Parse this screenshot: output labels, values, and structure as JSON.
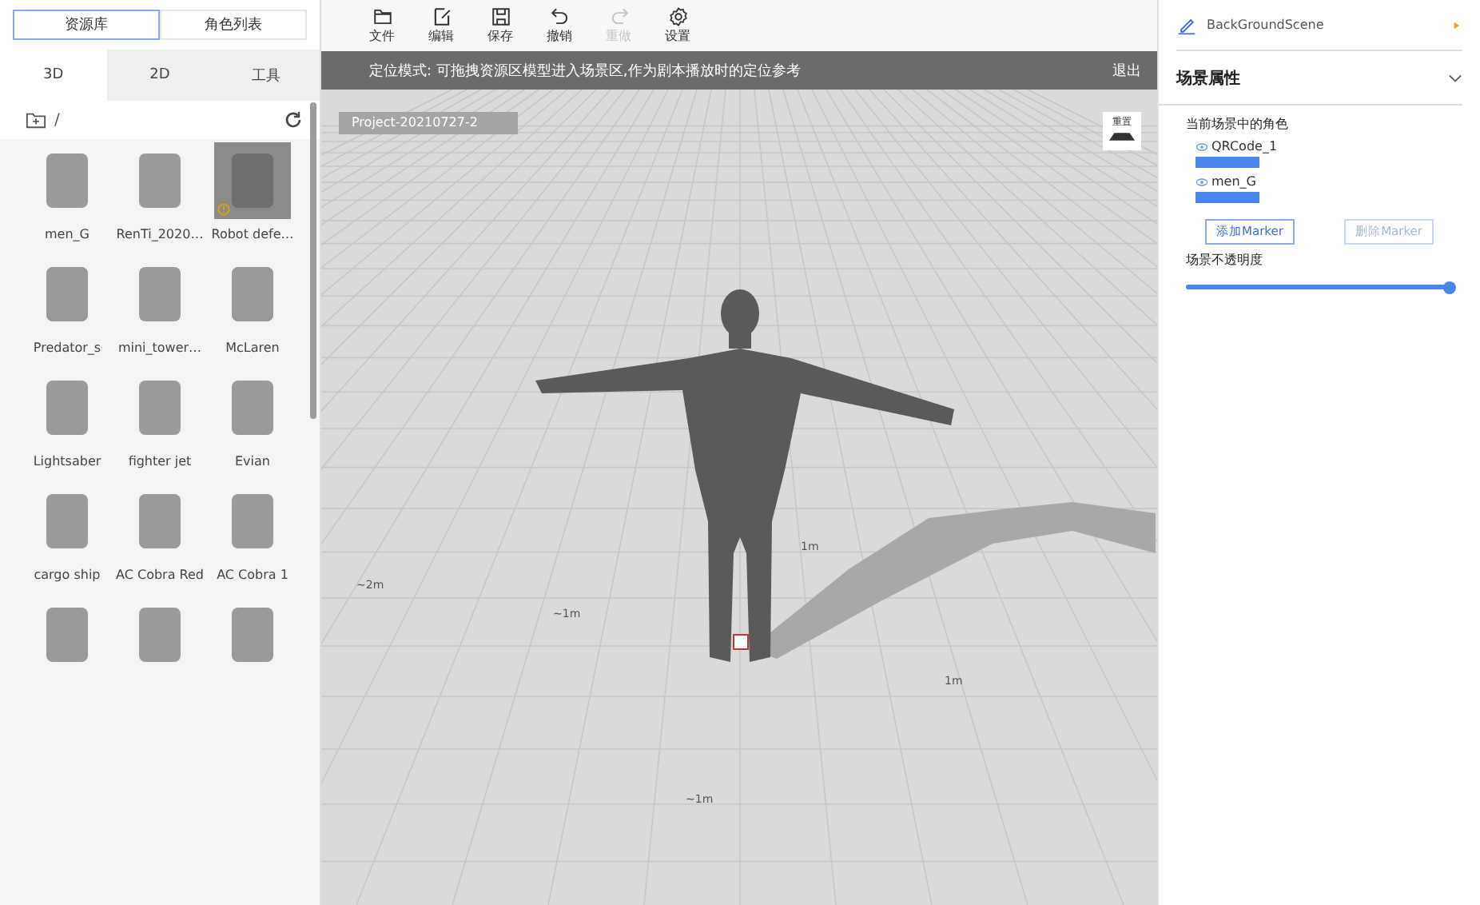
{
  "library_switch": [
    {
      "label": "资源库",
      "selected": true
    },
    {
      "label": "角色列表",
      "selected": false
    }
  ],
  "tabs": [
    {
      "label": "3D",
      "selected": true
    },
    {
      "label": "2D",
      "selected": false
    },
    {
      "label": "工具",
      "selected": false
    }
  ],
  "path": "/",
  "assets": [
    {
      "label": "men_G",
      "selected": false,
      "warning": false
    },
    {
      "label": "RenTi_2020…",
      "selected": false,
      "warning": false
    },
    {
      "label": "Robot defe…",
      "selected": true,
      "warning": true
    },
    {
      "label": "Predator_s",
      "selected": false,
      "warning": false
    },
    {
      "label": "mini_tower…",
      "selected": false,
      "warning": false
    },
    {
      "label": "McLaren",
      "selected": false,
      "warning": false
    },
    {
      "label": "Lightsaber",
      "selected": false,
      "warning": false
    },
    {
      "label": "fighter jet",
      "selected": false,
      "warning": false
    },
    {
      "label": "Evian",
      "selected": false,
      "warning": false
    },
    {
      "label": "cargo ship",
      "selected": false,
      "warning": false
    },
    {
      "label": "AC Cobra Red",
      "selected": false,
      "warning": false
    },
    {
      "label": "AC Cobra 1",
      "selected": false,
      "warning": false
    },
    {
      "selected": false,
      "warning": false
    },
    {
      "selected": false,
      "warning": false
    },
    {
      "selected": false,
      "warning": false
    }
  ],
  "toolbar": [
    {
      "kind": "folder",
      "label": "文件",
      "disabled": false
    },
    {
      "kind": "edit",
      "label": "编辑",
      "disabled": false
    },
    {
      "kind": "save",
      "label": "保存",
      "disabled": false
    },
    {
      "kind": "undo",
      "label": "撤销",
      "disabled": false
    },
    {
      "kind": "redo",
      "label": "重做",
      "disabled": true
    },
    {
      "kind": "settings",
      "label": "设置",
      "disabled": false
    }
  ],
  "banner": {
    "text": "定位模式: 可拖拽资源区模型进入场景区,作为剧本播放时的定位参考",
    "exit": "退出"
  },
  "viewport": {
    "project": "Project-20210727-2",
    "reset": "重置",
    "grid_labels": [
      "~2m",
      "~1m",
      "1m",
      "1m",
      "~1m"
    ]
  },
  "scene": {
    "name": "BackGroundScene",
    "section": "场景属性",
    "roles_title": "当前场景中的角色",
    "roles": [
      {
        "name": "QRCode_1"
      },
      {
        "name": "men_G"
      }
    ],
    "buttons": [
      {
        "label": "添加Marker",
        "disabled": false
      },
      {
        "label": "删除Marker",
        "disabled": true
      }
    ],
    "opacity_label": "场景不透明度",
    "opacity": {
      "level": 1.0
    }
  }
}
